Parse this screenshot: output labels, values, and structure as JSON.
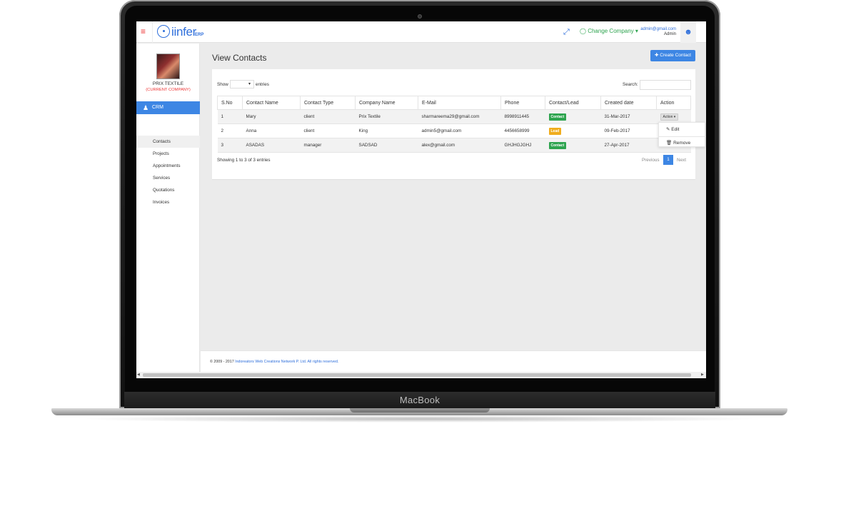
{
  "device": {
    "brand_label": "MacBook"
  },
  "topbar": {
    "menu_icon": "hamburger-icon",
    "logo_text": "iinfer",
    "logo_sub": "ERP",
    "expand_icon": "expand-icon",
    "change_company": "Change Company",
    "user_email": "admin@gmail.com",
    "user_role": "Admin",
    "user_icon": "user-icon"
  },
  "sidebar": {
    "company_name": "PRIX TEXTILE",
    "company_current": "(CURRENT COMPANY)",
    "crm_label": "CRM",
    "items": [
      {
        "label": "Contacts"
      },
      {
        "label": "Projects"
      },
      {
        "label": "Appointments"
      },
      {
        "label": "Services"
      },
      {
        "label": "Quotations"
      },
      {
        "label": "Invoices"
      }
    ]
  },
  "main": {
    "title": "View Contacts",
    "create_button": "Create Contact",
    "show_label": "Show",
    "entries_label": "entries",
    "search_label": "Search:",
    "columns": [
      "S.No",
      "Contact Name",
      "Contact Type",
      "Company Name",
      "E-Mail",
      "Phone",
      "Contact/Lead",
      "Created date",
      "Action"
    ],
    "rows": [
      {
        "sno": "1",
        "name": "Mary",
        "type": "client",
        "company": "Prix Textile",
        "email": "sharmareema29@gmail.com",
        "phone": "8998911445",
        "status": "Contact",
        "status_color": "#2ea44f",
        "created": "31-Mar-2017",
        "action": "Action"
      },
      {
        "sno": "2",
        "name": "Anna",
        "type": "client",
        "company": "King",
        "email": "admin5@gmail.com",
        "phone": "4456658999",
        "status": "Lead",
        "status_color": "#f0ad1e",
        "created": "09-Feb-2017",
        "action": ""
      },
      {
        "sno": "3",
        "name": "ASADAS",
        "type": "manager",
        "company": "SADSAD",
        "email": "alex@gmail.com",
        "phone": "GHJHGJGHJ",
        "status": "Contact",
        "status_color": "#2ea44f",
        "created": "27-Apr-2017",
        "action": ""
      }
    ],
    "dropdown": {
      "edit": "Edit",
      "remove": "Remove"
    },
    "showing": "Showing 1 to 3 of 3 entries",
    "pagination": {
      "previous": "Previous",
      "current": "1",
      "next": "Next"
    }
  },
  "footer": {
    "prefix": "© 2009 - 2017 ",
    "link": "Indoreators Web Creations Network P. Ltd. All rights reserved."
  }
}
